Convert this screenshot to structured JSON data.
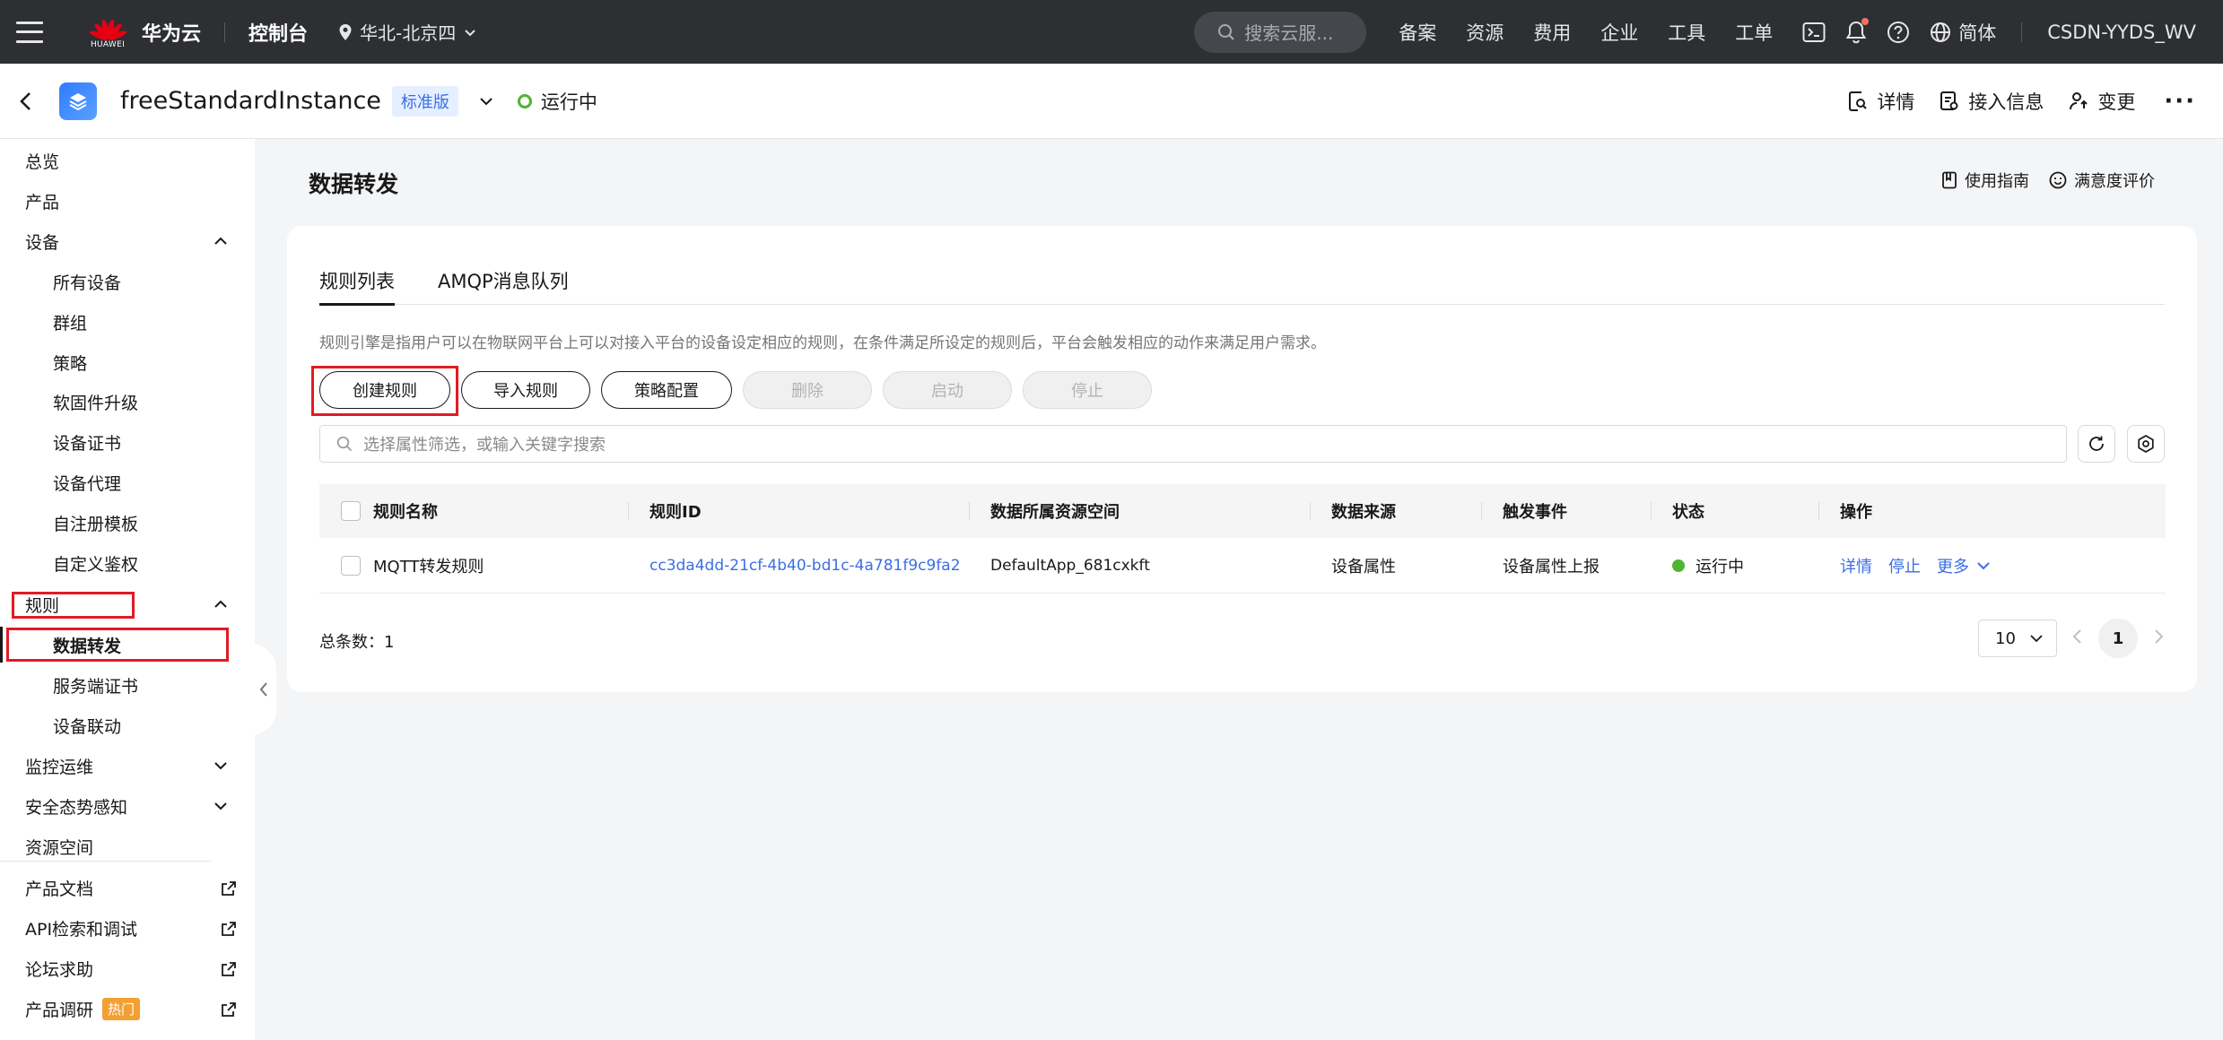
{
  "topnav": {
    "logo_text": "HUAWEI",
    "brand": "华为云",
    "console": "控制台",
    "region": "华北-北京四",
    "search_placeholder": "搜索云服...",
    "links": [
      "备案",
      "资源",
      "费用",
      "企业",
      "工具",
      "工单"
    ],
    "language": "简体",
    "account": "CSDN-YYDS_WV"
  },
  "instance": {
    "name": "freeStandardInstance",
    "edition": "标准版",
    "status": "运行中",
    "actions": {
      "detail": "详情",
      "access": "接入信息",
      "change": "变更",
      "more": "···"
    }
  },
  "sidebar": {
    "overview": "总览",
    "product": "产品",
    "device": "设备",
    "device_children": [
      "所有设备",
      "群组",
      "策略",
      "软固件升级",
      "设备证书",
      "设备代理",
      "自注册模板",
      "自定义鉴权"
    ],
    "rules": "规则",
    "rules_children": [
      "数据转发",
      "服务端证书",
      "设备联动"
    ],
    "monitor": "监控运维",
    "security": "安全态势感知",
    "resource_space": "资源空间",
    "product_docs": "产品文档",
    "api_explorer": "API检索和调试",
    "forum": "论坛求助",
    "survey": "产品调研",
    "survey_badge": "热门"
  },
  "page": {
    "title": "数据转发",
    "guide": "使用指南",
    "rating": "满意度评价"
  },
  "tabs": [
    "规则列表",
    "AMQP消息队列"
  ],
  "description": "规则引擎是指用户可以在物联网平台上可以对接入平台的设备设定相应的规则，在条件满足所设定的规则后，平台会触发相应的动作来满足用户需求。",
  "buttons": {
    "create": "创建规则",
    "import": "导入规则",
    "policy": "策略配置",
    "delete": "删除",
    "start": "启动",
    "stop": "停止"
  },
  "search": {
    "placeholder": "选择属性筛选，或输入关键字搜索"
  },
  "table": {
    "headers": [
      "规则名称",
      "规则ID",
      "数据所属资源空间",
      "数据来源",
      "触发事件",
      "状态",
      "操作"
    ],
    "rows": [
      {
        "name": "MQTT转发规则",
        "id": "cc3da4dd-21cf-4b40-bd1c-4a781f9c9fa2",
        "space": "DefaultApp_681cxkft",
        "source": "设备属性",
        "event": "设备属性上报",
        "status": "运行中",
        "ops": {
          "detail": "详情",
          "stop": "停止",
          "more": "更多"
        }
      }
    ]
  },
  "pagination": {
    "total_label": "总条数：",
    "total": "1",
    "page_size": "10",
    "current_page": "1"
  },
  "colors": {
    "topnav_bg": "#2d2f33",
    "link_blue": "#3b6ee5",
    "status_green": "#50b432",
    "highlight_red": "#e11b22",
    "hot_orange": "#f2a033"
  }
}
